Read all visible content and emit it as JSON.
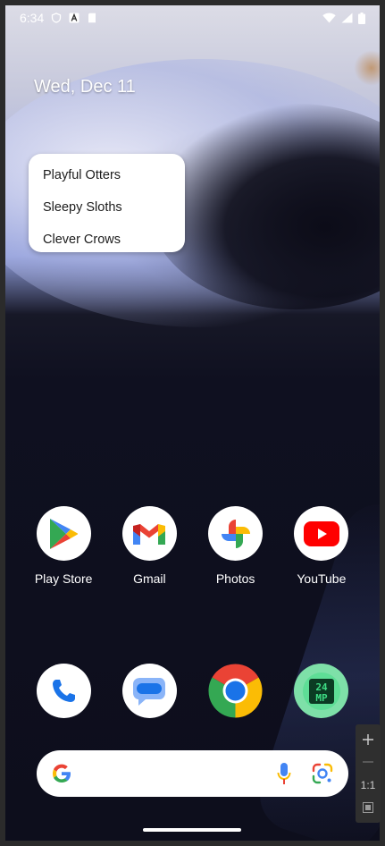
{
  "status_bar": {
    "time": "6:34"
  },
  "date_widget": "Wed, Dec 11",
  "popup_menu": {
    "items": [
      "Playful Otters",
      "Sleepy Sloths",
      "Clever Crows"
    ]
  },
  "apps_row1": [
    {
      "label": "Play Store",
      "icon": "play-store-icon"
    },
    {
      "label": "Gmail",
      "icon": "gmail-icon"
    },
    {
      "label": "Photos",
      "icon": "photos-icon"
    },
    {
      "label": "YouTube",
      "icon": "youtube-icon"
    }
  ],
  "dock": [
    {
      "icon": "phone-icon"
    },
    {
      "icon": "messages-icon"
    },
    {
      "icon": "chrome-icon"
    },
    {
      "icon": "camera-24mp-icon",
      "badge_text": "24MP"
    }
  ],
  "zoom_panel": {
    "reset_label": "1:1"
  },
  "colors": {
    "google_blue": "#4285F4",
    "google_red": "#EA4335",
    "google_yellow": "#FBBC05",
    "google_green": "#34A853"
  }
}
